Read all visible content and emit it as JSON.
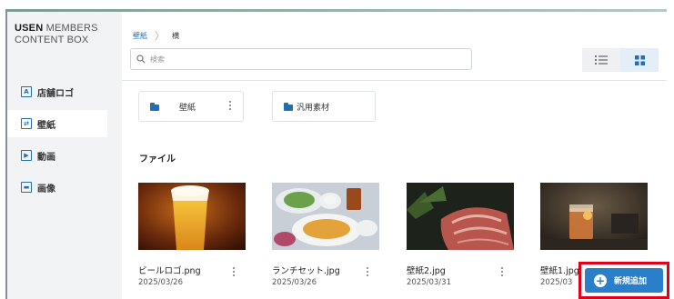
{
  "brand": {
    "name_bold": "USEN",
    "name_rest": " MEMBERS",
    "line2": "CONTENT BOX"
  },
  "sidebar": {
    "items": [
      {
        "label": "店舗ロゴ",
        "icon": "A",
        "active": false
      },
      {
        "label": "壁紙",
        "icon": "⇄",
        "active": true
      },
      {
        "label": "動画",
        "icon": "▶",
        "active": false
      },
      {
        "label": "画像",
        "icon": "▬",
        "active": false
      }
    ]
  },
  "breadcrumb": {
    "parent": "壁紙",
    "current": "横"
  },
  "search": {
    "placeholder": "検索"
  },
  "folders": [
    {
      "label": "壁紙"
    },
    {
      "label": "汎用素材"
    }
  ],
  "section_title": "ファイル",
  "files": [
    {
      "name": "ビールロゴ.png",
      "date": "2025/03/26"
    },
    {
      "name": "ランチセット.jpg",
      "date": "2025/03/26"
    },
    {
      "name": "壁紙2.jpg",
      "date": "2025/03/31"
    },
    {
      "name": "壁紙1.jpg",
      "date": "2025/03"
    }
  ],
  "add_button": {
    "label": "新規追加"
  },
  "colors": {
    "accent": "#1f6fb2",
    "button": "#2a7fc9",
    "highlight": "#e0001b"
  }
}
